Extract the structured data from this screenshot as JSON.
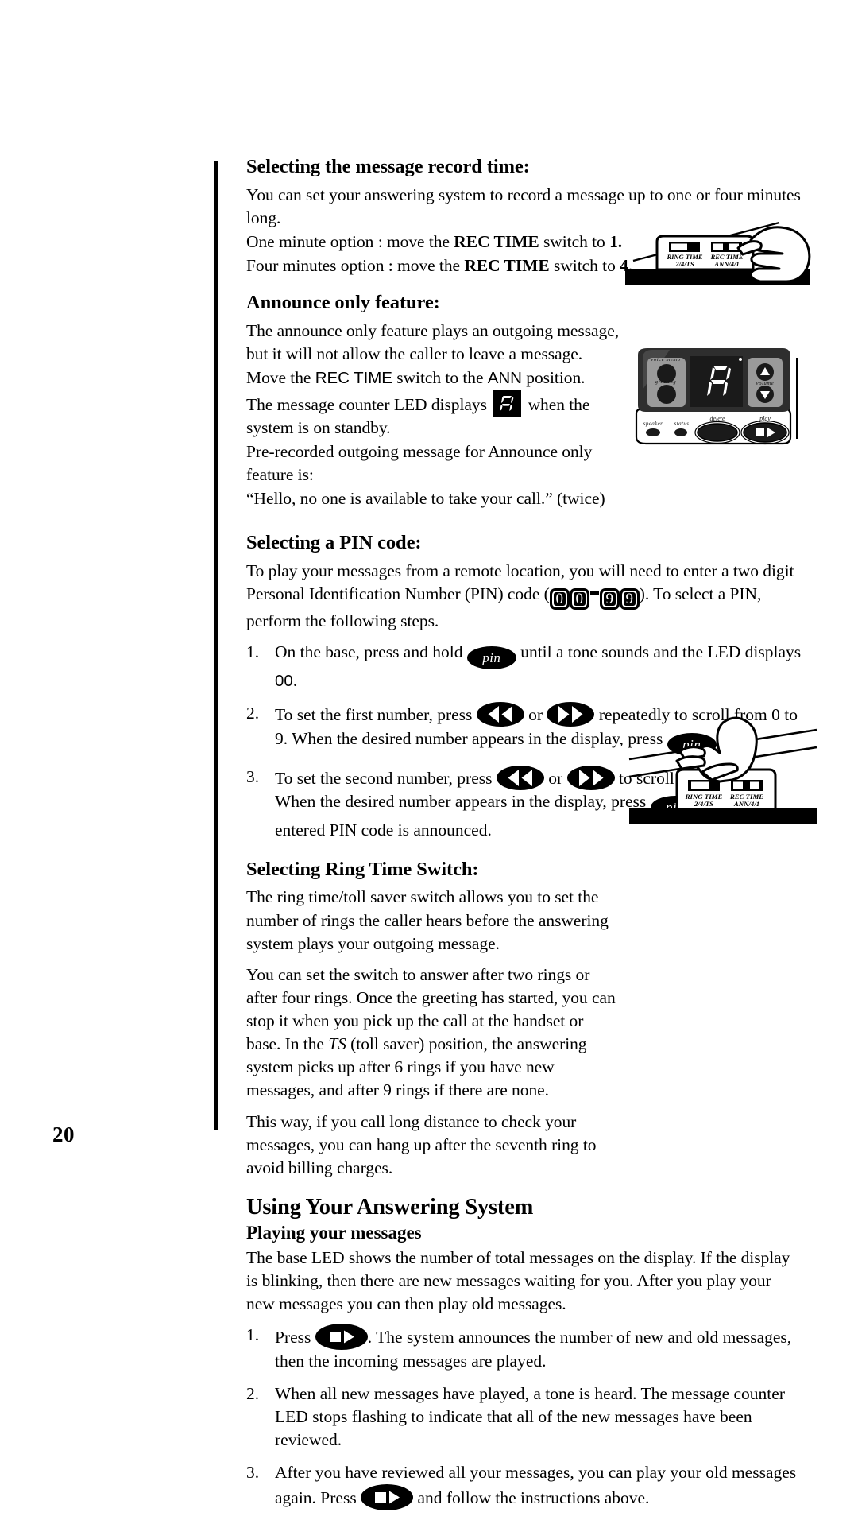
{
  "page": {
    "number": "20"
  },
  "sections": {
    "record_time": {
      "heading": "Selecting the message record time:",
      "p1": "You can set your answering system to record a message up to one or four minutes long.",
      "p2_pre": "One minute option : move the ",
      "p2_switch": "REC TIME",
      "p2_mid": " switch to ",
      "p2_val": "1.",
      "p3_pre": "Four minutes option : move the ",
      "p3_switch": "REC TIME",
      "p3_mid": " switch to ",
      "p3_val": "4."
    },
    "announce_only": {
      "heading": "Announce only feature:",
      "p1_a": "The announce only feature plays an outgoing message, but it will not allow the caller to leave a message. Move the ",
      "p1_rec": "REC TIME",
      "p1_b": " switch to the ",
      "p1_ann": "ANN",
      "p1_c": " position.",
      "p2_a": "The message counter LED displays",
      "p2_led": "A",
      "p2_b": "when the system is on standby.",
      "p3": "Pre-recorded outgoing message for Announce only feature is:",
      "p4": "“Hello, no one is available to take your call.” (twice)"
    },
    "pin_code": {
      "heading": "Selecting a PIN code:",
      "p1_a": "To play your messages from a remote location, you will need to enter a two digit Personal Identification Number (PIN) code (",
      "pin_digits": [
        "0",
        "0",
        "9",
        "9"
      ],
      "p1_b": "). To select a PIN, perform the following steps.",
      "steps": [
        {
          "num": "1.",
          "a": "On the base, press and hold",
          "btn1": "pin",
          "b": "until a tone sounds and the LED displays",
          "led_value": "00",
          "c": "."
        },
        {
          "num": "2.",
          "a": "To set the first number, press",
          "btn_rew": "rewind",
          "or": "or",
          "btn_ff": "fast-forward",
          "b": "repeatedly to scroll from 0 to 9. When the desired number appears in the display, press",
          "btn2": "pin",
          "c": "."
        },
        {
          "num": "3.",
          "a": "To set the second number, press",
          "btn_rew": "rewind",
          "or": "or",
          "btn_ff": "fast-forward",
          "b": "to scroll from 0 to 9. When the desired number appears in the display, press",
          "btn2": "pin",
          "c": ". Then the entered PIN code is announced."
        }
      ]
    },
    "ring_time": {
      "heading": "Selecting Ring Time Switch:",
      "p1": "The ring time/toll saver switch allows you to set the number of rings the caller hears before the answering system plays your outgoing message.",
      "p2_a": "You can set the switch to answer after two rings or after four rings. Once the greeting has started, you can stop it when you pick up the call at the handset or base. In the ",
      "p2_ts": "TS",
      "p2_b": " (toll saver) position, the answering system picks up after 6 rings if you have new messages, and after 9 rings if there are none.",
      "p3": "This way, if you call long distance to check your messages, you can hang up after the seventh ring to avoid billing charges."
    },
    "using_system": {
      "heading": "Using Your Answering System",
      "subheading": "Playing your messages",
      "p1": "The base LED shows the number of total messages on the display. If the display is blinking, then there are new messages waiting for you. After you play your new messages you can then play old messages.",
      "steps": [
        {
          "num": "1.",
          "a": "Press",
          "btn": "play",
          "b": ". The system announces the number of new and old messages, then the incoming messages are played."
        },
        {
          "num": "2.",
          "a": "When all new messages have played, a tone is heard. The message counter LED stops flashing to indicate that all of the new messages have been reviewed."
        },
        {
          "num": "3.",
          "a": "After you have reviewed all your messages, you can play your old messages again. Press",
          "btn": "play",
          "b": "and follow the instructions above."
        }
      ]
    }
  },
  "illustrations": {
    "switch_panel_top": {
      "caption": "hand moving REC TIME switch on base unit",
      "switch1_label_line1": "RING TIME",
      "switch1_label_line2": "2/4/TS",
      "switch2_label_line1": "REC TIME",
      "switch2_label_line2": "ANN/4/1"
    },
    "base_unit": {
      "caption": "answering system base control panel",
      "voice_memo": "voice memo",
      "greeting": "greeting",
      "volume": "volume",
      "speaker": "speaker",
      "status": "status",
      "delete": "delete",
      "play": "play",
      "led_display": "A"
    },
    "switch_panel_bottom": {
      "caption": "hand moving RING TIME switch on base unit",
      "switch1_label_line1": "RING TIME",
      "switch1_label_line2": "2/4/TS",
      "switch2_label_line1": "REC TIME",
      "switch2_label_line2": "ANN/4/1"
    }
  },
  "colors": {
    "ink": "#000000",
    "paper": "#ffffff",
    "panel_gray": "#9a9a9a",
    "panel_dark": "#3a3a3a"
  }
}
